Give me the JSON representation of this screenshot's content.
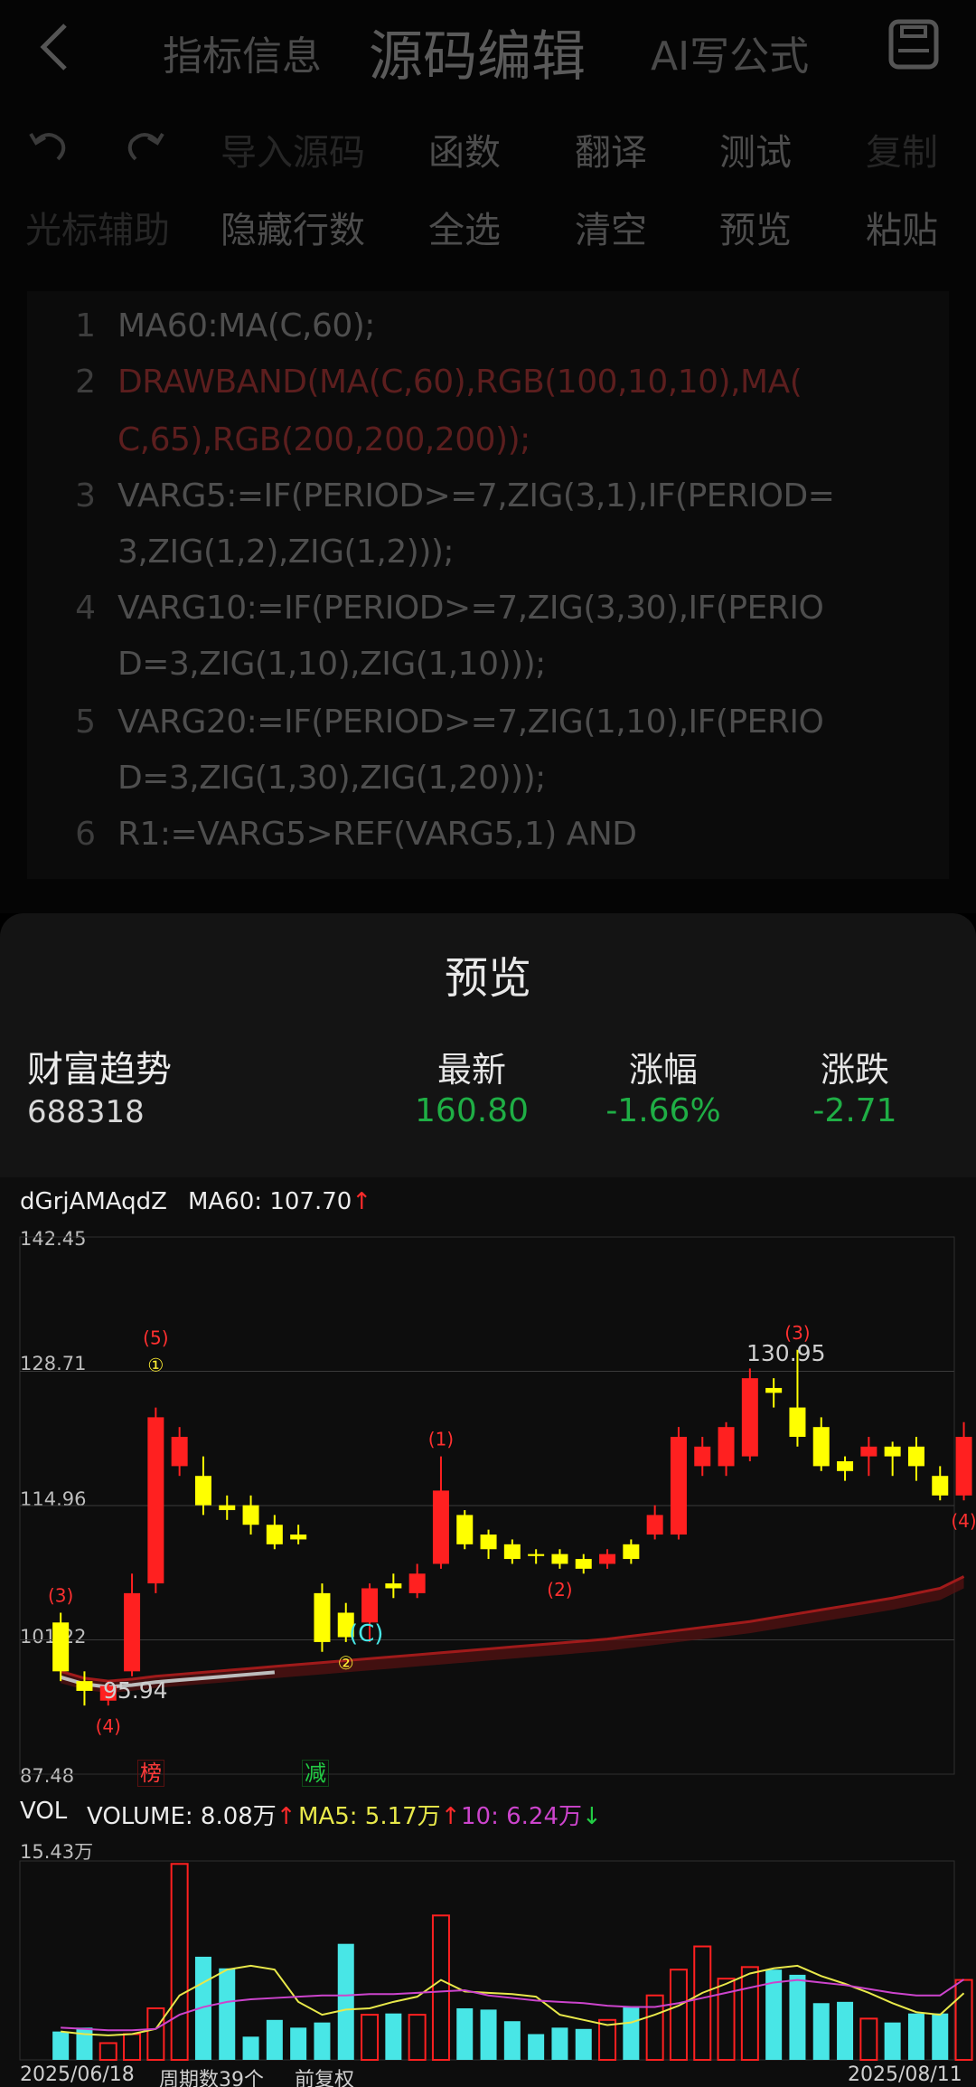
{
  "header": {
    "tabs": [
      "指标信息",
      "源码编辑",
      "AI写公式"
    ],
    "active_tab": "源码编辑"
  },
  "toolbar": {
    "row1": [
      "导入源码",
      "函数",
      "翻译",
      "测试",
      "复制"
    ],
    "row2": [
      "光标辅助",
      "隐藏行数",
      "全选",
      "清空",
      "预览",
      "粘贴"
    ]
  },
  "code": {
    "line_numbers": [
      "1",
      "2",
      "3",
      "4",
      "5",
      "6"
    ],
    "lines": [
      "MA60:MA(C,60);",
      "DRAWBAND(MA(C,60),RGB(100,10,10),MA(",
      "C,65),RGB(200,200,200));",
      "VARG5:=IF(PERIOD>=7,ZIG(3,1),IF(PERIOD=",
      "3,ZIG(1,2),ZIG(1,2)));",
      "VARG10:=IF(PERIOD>=7,ZIG(3,30),IF(PERIO",
      "D=3,ZIG(1,10),ZIG(1,10)));",
      "VARG20:=IF(PERIOD>=7,ZIG(1,10),IF(PERIO",
      "D=3,ZIG(1,30),ZIG(1,20)));",
      "R1:=VARG5>REF(VARG5,1) AND"
    ]
  },
  "preview": {
    "title": "预览",
    "stock_name": "财富趋势",
    "stock_code": "688318",
    "quote_labels": [
      "最新",
      "涨幅",
      "涨跌"
    ],
    "quote_values": [
      "160.80",
      "-1.66%",
      "-2.71"
    ]
  },
  "chart": {
    "main_legend_name": "dGrjAMAqdZ",
    "ma60_label": "MA60: 107.70",
    "y_ticks": [
      "142.45",
      "128.71",
      "114.96",
      "101.22",
      "87.48"
    ],
    "price_high_label": "130.95",
    "price_low_label": "95.94",
    "flags": [
      "榜",
      "减"
    ],
    "marker_c": "(C)",
    "vol_legend": {
      "name": "VOL",
      "volume": "VOLUME: 8.08万",
      "ma5": "MA5: 5.17万",
      "ma10": "10: 6.24万"
    },
    "vol_max_label": "15.43万",
    "date_start": "2025/06/18",
    "period_count": "周期数39个",
    "adjust_mode": "前复权",
    "date_end": "2025/08/11",
    "colors": {
      "up": "#ff2020",
      "down": "#ffff00",
      "ma60": "#a01a1a",
      "vol_down": "#48e6e6",
      "ma5_line": "#e8e84a",
      "ma10_line": "#cc44cc"
    }
  },
  "chart_data": {
    "type": "candlestick",
    "ylim": [
      87.48,
      142.45
    ],
    "candles": [
      {
        "o": 103,
        "c": 98,
        "h": 104,
        "l": 97
      },
      {
        "o": 97,
        "c": 96,
        "h": 98,
        "l": 94.5
      },
      {
        "o": 95,
        "c": 96.5,
        "h": 97,
        "l": 94.5
      },
      {
        "o": 98,
        "c": 106,
        "h": 108,
        "l": 97.5
      },
      {
        "o": 107,
        "c": 124,
        "h": 125,
        "l": 106
      },
      {
        "o": 119,
        "c": 122,
        "h": 123,
        "l": 118
      },
      {
        "o": 118,
        "c": 115,
        "h": 120,
        "l": 114
      },
      {
        "o": 115,
        "c": 114.5,
        "h": 116,
        "l": 113.5
      },
      {
        "o": 115,
        "c": 113,
        "h": 116,
        "l": 112
      },
      {
        "o": 113,
        "c": 111,
        "h": 114,
        "l": 110.5
      },
      {
        "o": 112,
        "c": 111.5,
        "h": 113,
        "l": 111
      },
      {
        "o": 106,
        "c": 101,
        "h": 107,
        "l": 100
      },
      {
        "o": 104,
        "c": 101.5,
        "h": 105,
        "l": 101
      },
      {
        "o": 103,
        "c": 106.5,
        "h": 107,
        "l": 101
      },
      {
        "o": 107,
        "c": 106.5,
        "h": 108,
        "l": 105.5
      },
      {
        "o": 106,
        "c": 108,
        "h": 109,
        "l": 105.5
      },
      {
        "o": 109,
        "c": 116.5,
        "h": 120,
        "l": 108.5
      },
      {
        "o": 114,
        "c": 111,
        "h": 114.5,
        "l": 110.5
      },
      {
        "o": 112,
        "c": 110.5,
        "h": 112.5,
        "l": 109.5
      },
      {
        "o": 111,
        "c": 109.5,
        "h": 111.5,
        "l": 109
      },
      {
        "o": 110,
        "c": 109.8,
        "h": 110.5,
        "l": 109
      },
      {
        "o": 110,
        "c": 109,
        "h": 110.5,
        "l": 108.5
      },
      {
        "o": 109.5,
        "c": 108.5,
        "h": 110,
        "l": 108
      },
      {
        "o": 109,
        "c": 110,
        "h": 110.5,
        "l": 108.5
      },
      {
        "o": 111,
        "c": 109.5,
        "h": 111.5,
        "l": 109
      },
      {
        "o": 112,
        "c": 114,
        "h": 115,
        "l": 111.5
      },
      {
        "o": 112,
        "c": 122,
        "h": 123,
        "l": 111.5
      },
      {
        "o": 119,
        "c": 121,
        "h": 122,
        "l": 118
      },
      {
        "o": 119,
        "c": 123,
        "h": 123.5,
        "l": 118
      },
      {
        "o": 120,
        "c": 128,
        "h": 129,
        "l": 119.5
      },
      {
        "o": 127,
        "c": 126.5,
        "h": 128,
        "l": 125
      },
      {
        "o": 125,
        "c": 122,
        "h": 130.9,
        "l": 121
      },
      {
        "o": 123,
        "c": 119,
        "h": 124,
        "l": 118.5
      },
      {
        "o": 119.5,
        "c": 118.5,
        "h": 120,
        "l": 117.5
      },
      {
        "o": 120,
        "c": 121,
        "h": 122,
        "l": 118
      },
      {
        "o": 121,
        "c": 120,
        "h": 121.5,
        "l": 118
      },
      {
        "o": 121,
        "c": 119,
        "h": 122,
        "l": 117.5
      },
      {
        "o": 118,
        "c": 116,
        "h": 119,
        "l": 115.5
      },
      {
        "o": 116,
        "c": 122,
        "h": 123.5,
        "l": 115.5
      }
    ],
    "ma60": [
      98,
      97.3,
      97,
      97.2,
      97.5,
      97.7,
      97.9,
      98.1,
      98.3,
      98.5,
      98.7,
      98.9,
      99.1,
      99.3,
      99.5,
      99.7,
      99.9,
      100.1,
      100.3,
      100.5,
      100.7,
      100.9,
      101.1,
      101.3,
      101.6,
      101.9,
      102.2,
      102.5,
      102.8,
      103.1,
      103.5,
      103.9,
      104.3,
      104.7,
      105.1,
      105.5,
      106,
      106.5,
      107.7
    ],
    "volume_max": 15.43,
    "volume": [
      2.2,
      2.5,
      1.3,
      2.0,
      4.0,
      15.2,
      8.0,
      7.1,
      1.8,
      3.1,
      2.5,
      2.9,
      9.0,
      3.5,
      3.6,
      3.5,
      11.2,
      4.0,
      3.9,
      3.0,
      2.0,
      2.5,
      2.4,
      3.1,
      4.1,
      5.0,
      7.0,
      8.8,
      6.3,
      7.2,
      7.0,
      6.6,
      4.4,
      4.5,
      3.2,
      2.9,
      3.6,
      3.6,
      6.2
    ],
    "vol_ma5": [
      2.2,
      2.0,
      1.9,
      2.0,
      2.4,
      5.0,
      6.0,
      7.0,
      7.3,
      7.0,
      4.5,
      3.5,
      3.9,
      4.0,
      4.5,
      4.9,
      6.2,
      5.3,
      5.2,
      5.1,
      4.9,
      3.5,
      3.1,
      2.7,
      2.9,
      3.5,
      4.2,
      5.2,
      5.9,
      6.7,
      7.1,
      7.3,
      6.5,
      5.9,
      5.2,
      4.4,
      3.7,
      3.5,
      5.17
    ],
    "vol_ma10": [
      2.5,
      2.4,
      2.3,
      2.3,
      2.4,
      3.5,
      4.1,
      4.5,
      4.7,
      4.8,
      4.9,
      5.0,
      5.0,
      5.1,
      5.1,
      5.2,
      5.3,
      5.4,
      5.0,
      4.8,
      4.6,
      4.5,
      4.4,
      4.2,
      4.1,
      4.1,
      4.4,
      4.8,
      5.2,
      5.6,
      6.0,
      6.2,
      6.0,
      5.8,
      5.5,
      5.2,
      5.0,
      5.0,
      6.24
    ],
    "wave_labels": [
      {
        "i": 0,
        "text": "(3)",
        "pos": "above",
        "color": "red"
      },
      {
        "i": 2,
        "text": "(4)",
        "pos": "below",
        "color": "red"
      },
      {
        "i": 4,
        "text": "(5)",
        "pos": "above",
        "color": "red"
      },
      {
        "i": 4,
        "text": "①",
        "pos": "above2",
        "color": "yellow"
      },
      {
        "i": 12,
        "text": "②",
        "pos": "below",
        "color": "yellow"
      },
      {
        "i": 16,
        "text": "(1)",
        "pos": "above",
        "color": "red"
      },
      {
        "i": 21,
        "text": "(2)",
        "pos": "below",
        "color": "red"
      },
      {
        "i": 31,
        "text": "(3)",
        "pos": "above",
        "color": "red"
      },
      {
        "i": 38,
        "text": "(4)",
        "pos": "below",
        "color": "red"
      }
    ]
  }
}
